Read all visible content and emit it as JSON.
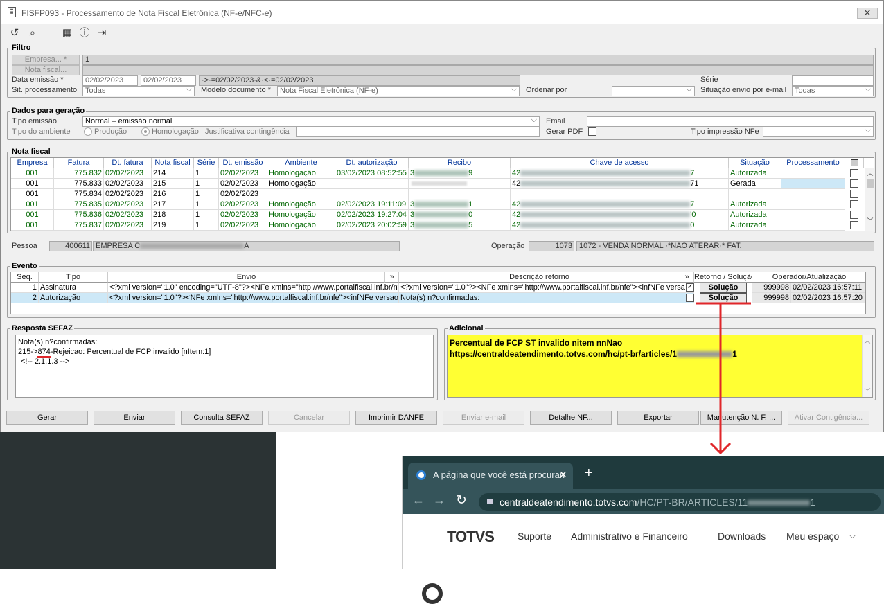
{
  "window": {
    "title": "FISFP093 - Processamento de Nota Fiscal Eletrônica (NF-e/NFC-e)",
    "close": "✕"
  },
  "toolbar": {
    "icons": [
      "refresh-icon",
      "search-icon",
      "calendar-icon",
      "help-icon",
      "exit-icon"
    ]
  },
  "filtro": {
    "legend": "Filtro",
    "empresa_btn": "Empresa... *",
    "empresa_val": "1",
    "nota_btn": "Nota fiscal...",
    "data_label": "Data emissão *",
    "data_from": "02/02/2023",
    "data_to": "02/02/2023",
    "data_expr": "·>·=02/02/2023·&·<·=02/02/2023",
    "serie_label": "Série",
    "sit_label": "Sit. processamento",
    "sit_val": "Todas",
    "modelo_label": "Modelo documento *",
    "modelo_val": "Nota Fiscal Eletrônica (NF-e)",
    "ordenar_label": "Ordenar por",
    "envio_label": "Situação envio por e-mail",
    "envio_val": "Todas"
  },
  "geracao": {
    "legend": "Dados para geração",
    "tipo_emissao_label": "Tipo emissão",
    "tipo_emissao_val": "Normal – emissão normal",
    "email_label": "Email",
    "ambiente_label": "Tipo do ambiente",
    "producao": "Produção",
    "homologacao": "Homologação",
    "justificativa_label": "Justificativa contingência",
    "gerar_pdf_label": "Gerar PDF",
    "tipo_impressao_label": "Tipo impressão NFe"
  },
  "nota": {
    "legend": "Nota fiscal",
    "headers": [
      "Empresa",
      "Fatura",
      "Dt. fatura",
      "Nota fiscal",
      "Série",
      "Dt. emissão",
      "Ambiente",
      "Dt. autorização",
      "Recibo",
      "Chave de acesso",
      "Situação",
      "Processamento"
    ],
    "rows": [
      {
        "empresa": "001",
        "fatura": "775.832",
        "dt_fatura": "02/02/2023",
        "nota": "214",
        "serie": "1",
        "dt_emissao": "02/02/2023",
        "ambiente": "Homologação",
        "dt_aut": "03/02/2023 08:52:55",
        "recibo_a": "3",
        "recibo_b": "9",
        "chave_a": "42",
        "chave_b": "7",
        "situacao": "Autorizada",
        "green": true
      },
      {
        "empresa": "001",
        "fatura": "775.833",
        "dt_fatura": "02/02/2023",
        "nota": "215",
        "serie": "1",
        "dt_emissao": "02/02/2023",
        "ambiente": "Homologação",
        "dt_aut": "",
        "recibo_a": "",
        "recibo_b": "",
        "chave_a": "42",
        "chave_b": "71",
        "situacao": "Gerada",
        "green": false
      },
      {
        "empresa": "001",
        "fatura": "775.834",
        "dt_fatura": "02/02/2023",
        "nota": "216",
        "serie": "1",
        "dt_emissao": "02/02/2023",
        "ambiente": "",
        "dt_aut": "",
        "recibo_a": "",
        "recibo_b": "",
        "chave_a": "",
        "chave_b": "",
        "situacao": "",
        "green": false
      },
      {
        "empresa": "001",
        "fatura": "775.835",
        "dt_fatura": "02/02/2023",
        "nota": "217",
        "serie": "1",
        "dt_emissao": "02/02/2023",
        "ambiente": "Homologação",
        "dt_aut": "02/02/2023 19:11:09",
        "recibo_a": "3",
        "recibo_b": "1",
        "chave_a": "42",
        "chave_b": "7",
        "situacao": "Autorizada",
        "green": true
      },
      {
        "empresa": "001",
        "fatura": "775.836",
        "dt_fatura": "02/02/2023",
        "nota": "218",
        "serie": "1",
        "dt_emissao": "02/02/2023",
        "ambiente": "Homologação",
        "dt_aut": "02/02/2023 19:27:04",
        "recibo_a": "3",
        "recibo_b": "0",
        "chave_a": "42",
        "chave_b": "'0",
        "situacao": "Autorizada",
        "green": true
      },
      {
        "empresa": "001",
        "fatura": "775.837",
        "dt_fatura": "02/02/2023",
        "nota": "219",
        "serie": "1",
        "dt_emissao": "02/02/2023",
        "ambiente": "Homologação",
        "dt_aut": "02/02/2023 20:02:59",
        "recibo_a": "3",
        "recibo_b": "5",
        "chave_a": "42",
        "chave_b": "0",
        "situacao": "Autorizada",
        "green": true
      }
    ]
  },
  "pessoa": {
    "label": "Pessoa",
    "code": "400611",
    "name_a": "EMPRESA C",
    "name_b": "A"
  },
  "operacao": {
    "label": "Operação",
    "code": "1073",
    "desc": "1072 - VENDA NORMAL ·*NAO ATERAR·* FAT."
  },
  "evento": {
    "legend": "Evento",
    "headers": [
      "Seq.",
      "Tipo",
      "Envio",
      "»",
      "Descrição retorno",
      "»",
      "Retorno / Solução",
      "Operador/Atualização"
    ],
    "rows": [
      {
        "seq": "1",
        "tipo": "Assinatura",
        "envio": "<?xml version=\"1.0\" encoding=\"UTF-8\"?><NFe xmlns=\"http://www.portalfiscal.inf.br/nf",
        "retorno": "<?xml version=\"1.0\"?><NFe xmlns=\"http://www.portalfiscal.inf.br/nfe\"><infNFe versa",
        "checked": "✓",
        "sol": "Solução",
        "op": "999998",
        "dt": "02/02/2023 16:57:11"
      },
      {
        "seq": "2",
        "tipo": "Autorização",
        "envio": "<?xml version=\"1.0\"?><NFe xmlns=\"http://www.portalfiscal.inf.br/nfe\"><infNFe versao",
        "retorno": "Nota(s) n?confirmadas:",
        "checked": "",
        "sol": "Solução",
        "op": "999998",
        "dt": "02/02/2023 16:57:20"
      }
    ]
  },
  "sefaz": {
    "legend": "Resposta SEFAZ",
    "line1": "Nota(s) n?confirmadas:",
    "line2a": "215->",
    "line2code": "874",
    "line2b": "-Rejeicao: Percentual de FCP invalido [nItem:1]",
    "line3": "<!--  2.1.1.3 -->"
  },
  "adicional": {
    "legend": "Adicional",
    "line1": "Percentual de FCP ST invalido nitem nnNao",
    "line2a": "https://centraldeatendimento.totvs.com/hc/pt-br/articles/1",
    "line2b": "1"
  },
  "buttons": [
    "Gerar",
    "Enviar",
    "Consulta SEFAZ",
    "Cancelar",
    "Imprimir DANFE",
    "Enviar e-mail",
    "Detalhe NF...",
    "Exportar",
    "Manutenção N. F. ...",
    "Ativar Contigência..."
  ],
  "browser": {
    "tab_title": "A página que você está procuran",
    "tab_close": "✕",
    "new_tab": "+",
    "url_a": "centraldeatendimento.totvs.com",
    "url_b": "/HC/PT-BR/ARTICLES/11",
    "url_c": "1",
    "logo": "TOTVS",
    "nav": [
      "Suporte",
      "Administrativo e Financeiro",
      "Downloads",
      "Meu espaço"
    ]
  },
  "colors": {
    "annotation": "#e0262a",
    "highlight": "#ffff33",
    "selected": "#cde8f7",
    "dark_panel": "#2b3334"
  }
}
